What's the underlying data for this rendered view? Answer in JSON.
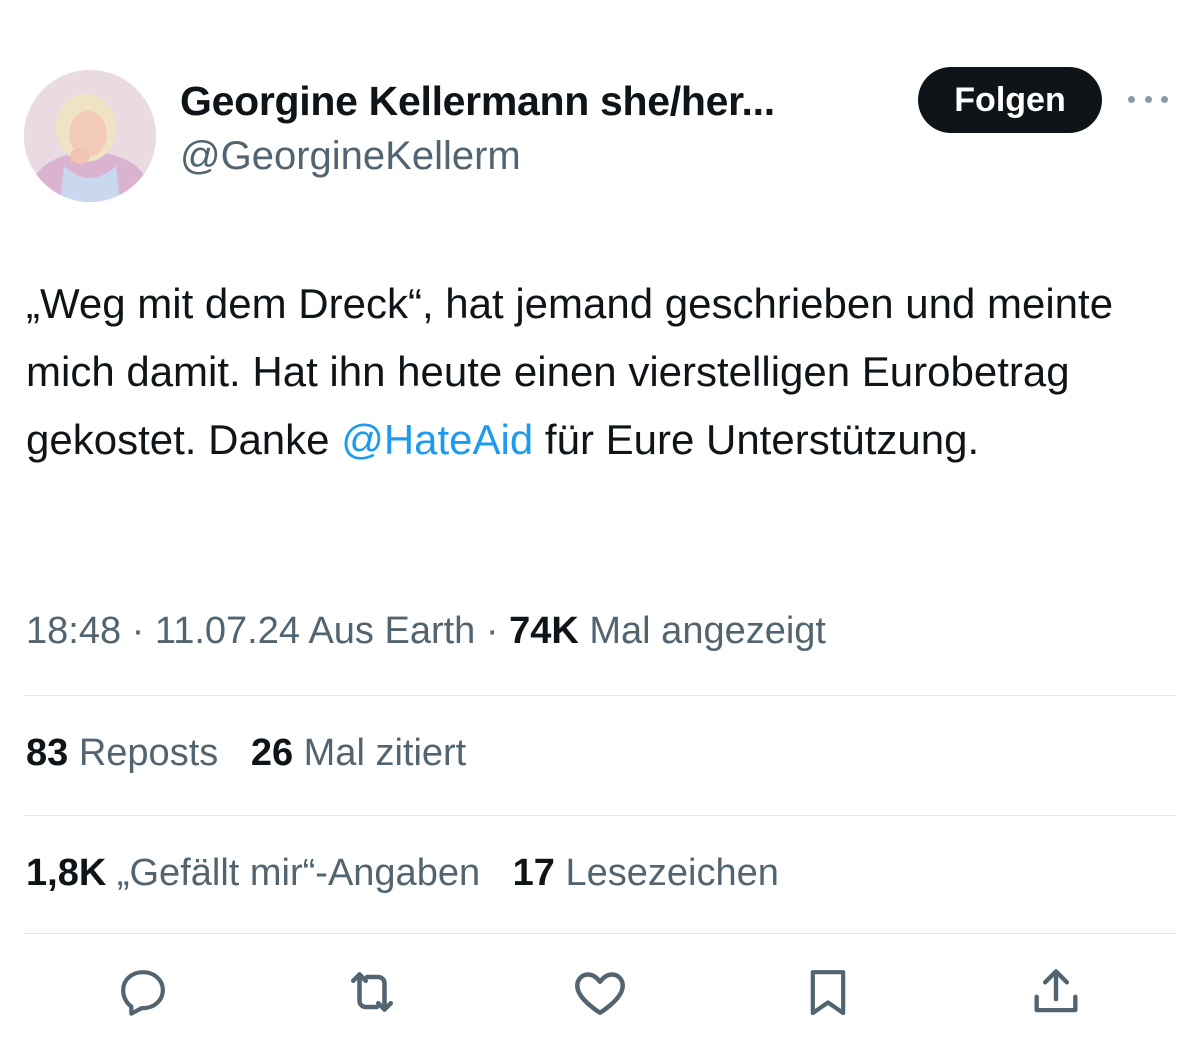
{
  "author": {
    "name": "Georgine Kellermann she/her...",
    "handle": "@GeorgineKellerm",
    "follow_label": "Folgen"
  },
  "tweet": {
    "text_before": "„Weg mit dem Dreck“, hat jemand geschrieben und meinte mich damit. Hat ihn heute einen vierstelligen Eurobetrag gekostet. Danke ",
    "mention": "@HateAid",
    "text_after": " für Eure Unterstützung."
  },
  "meta": {
    "time": "18:48",
    "date": "11.07.24",
    "source": "Aus Earth",
    "views_count": "74K",
    "views_label": "Mal angezeigt"
  },
  "stats": {
    "reposts_count": "83",
    "reposts_label": "Reposts",
    "quotes_count": "26",
    "quotes_label": "Mal zitiert",
    "likes_count": "1,8K",
    "likes_label": "„Gefällt mir“-Angaben",
    "bookmarks_count": "17",
    "bookmarks_label": "Lesezeichen"
  },
  "icons": {
    "reply": "reply-icon",
    "repost": "repost-icon",
    "like": "heart-icon",
    "bookmark": "bookmark-icon",
    "share": "share-icon",
    "more": "more-icon"
  },
  "colors": {
    "text": "#0f1419",
    "secondary": "#536471",
    "link": "#1d9bf0",
    "button": "#0f1419",
    "divider": "#e1e6ea"
  }
}
